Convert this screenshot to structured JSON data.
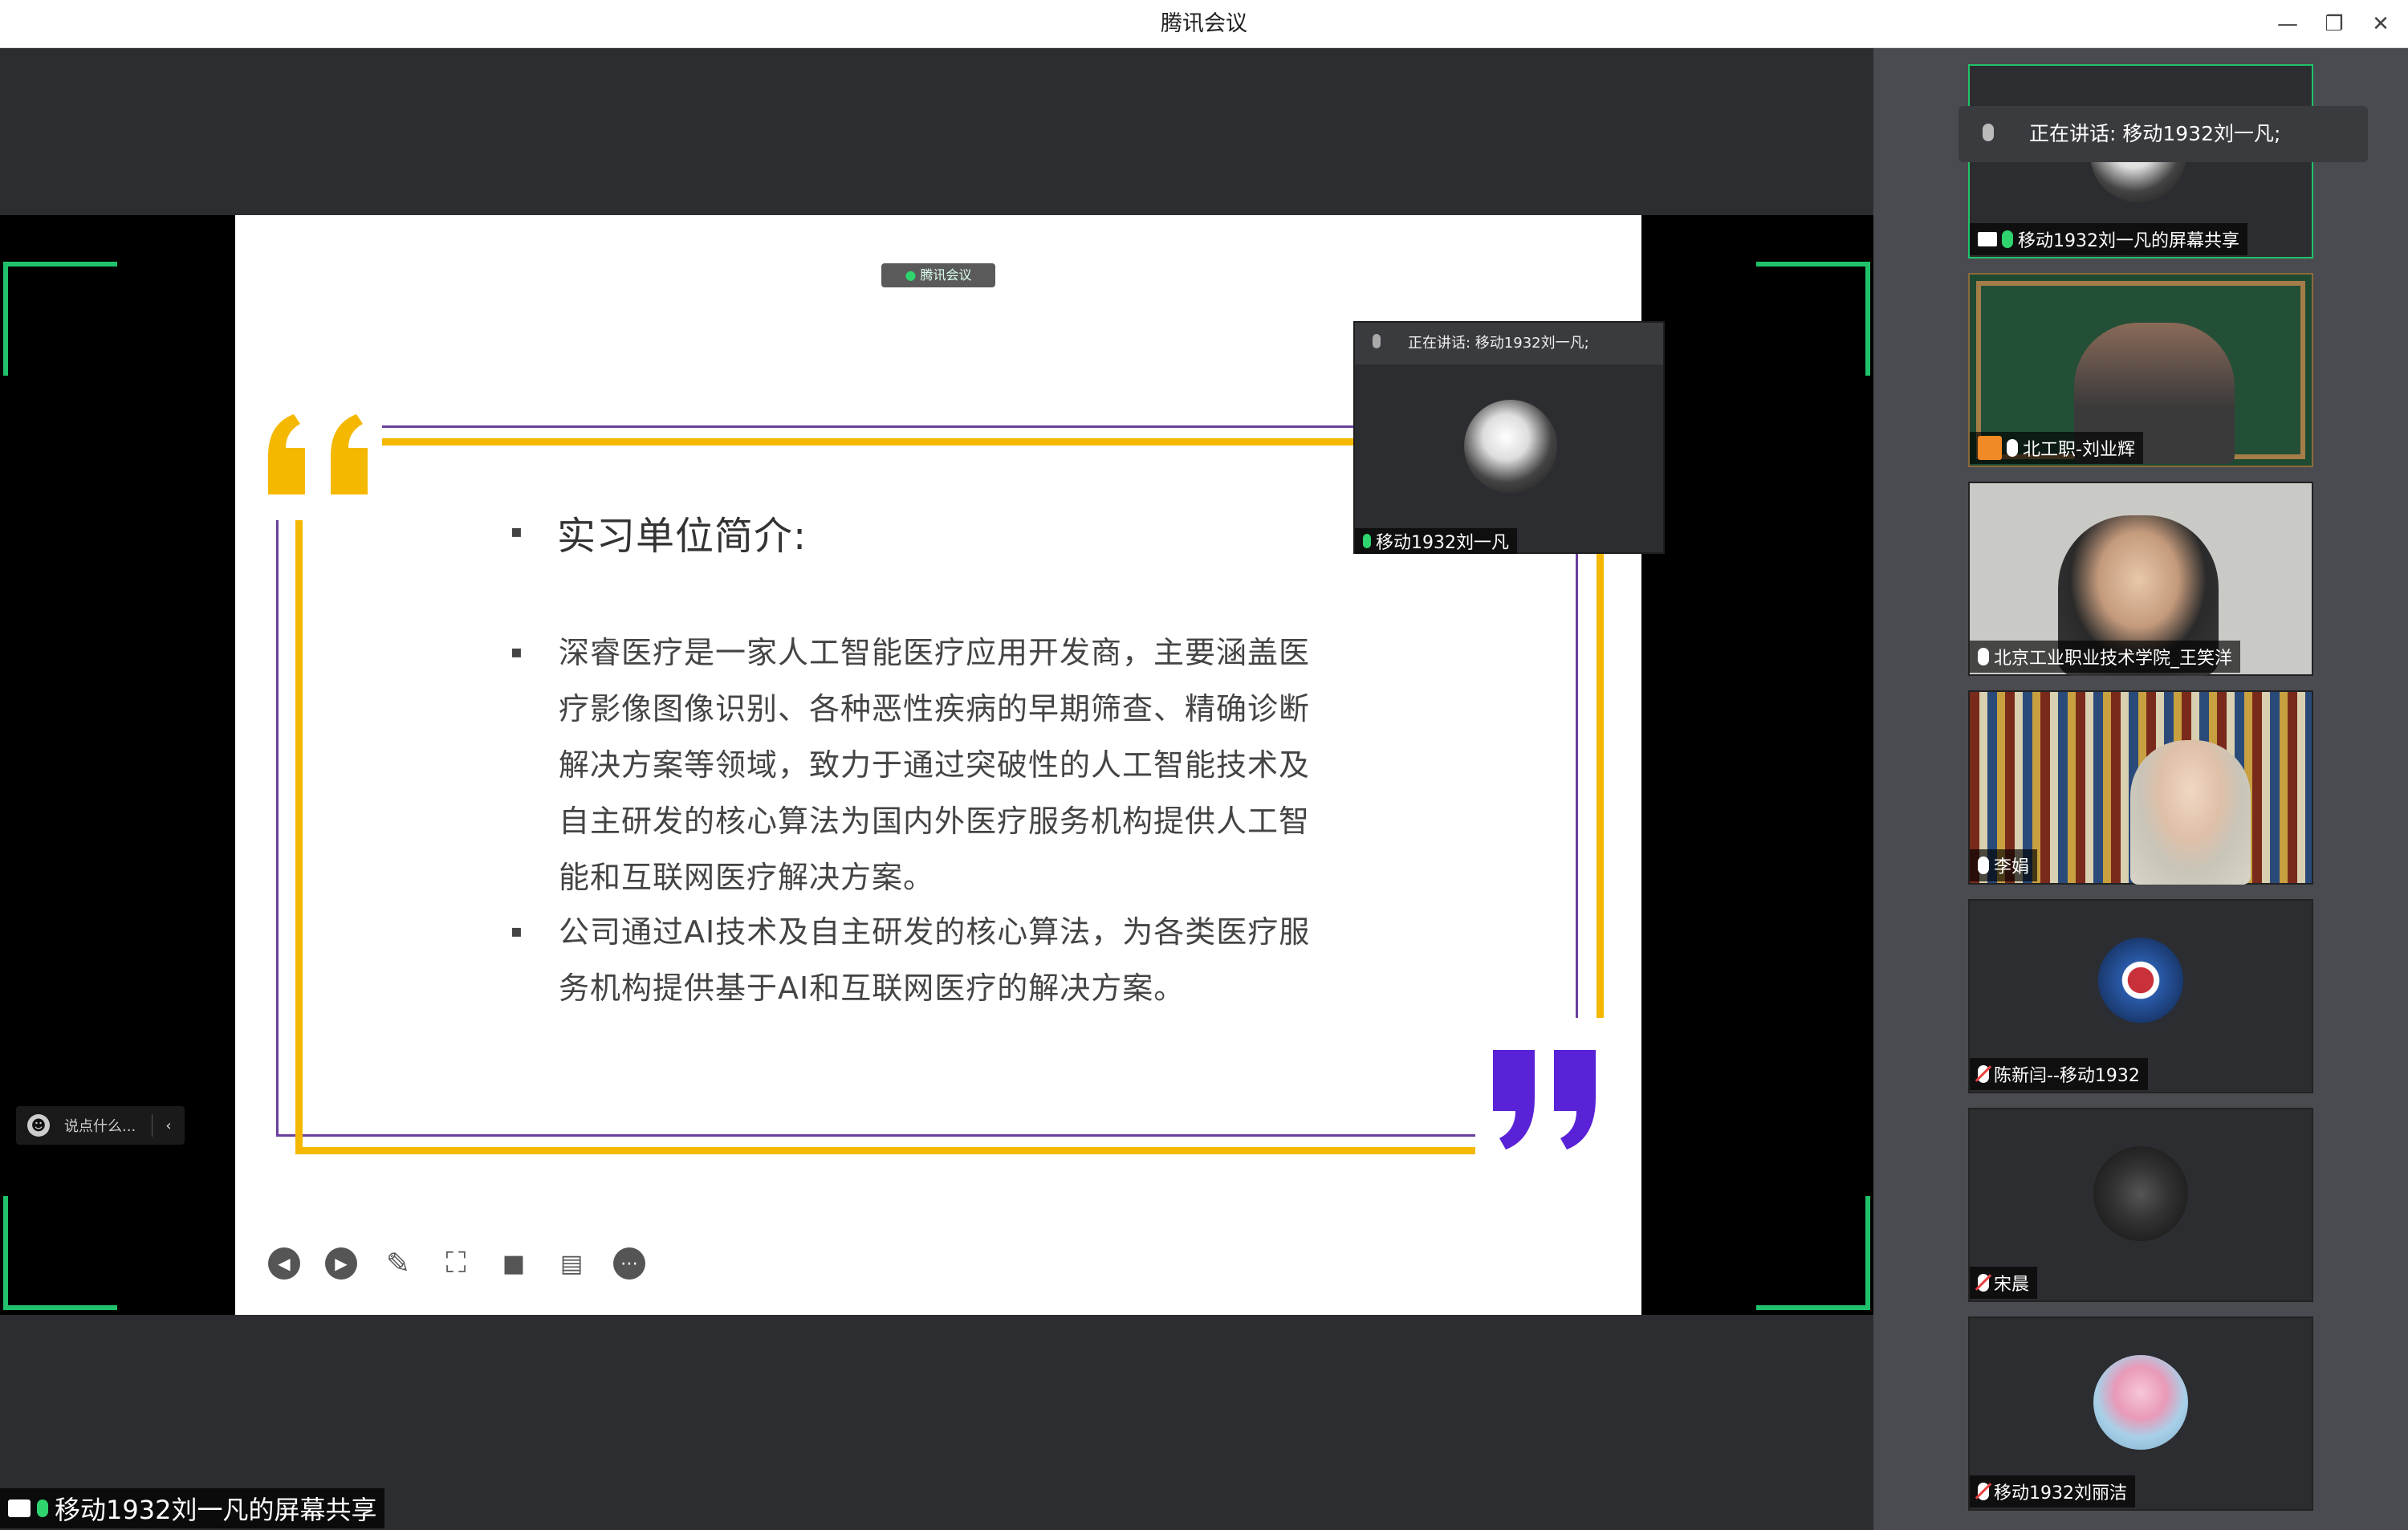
{
  "window": {
    "title": "腾讯会议"
  },
  "slide": {
    "heading": "实习单位简介:",
    "paragraphs": [
      [
        "深睿医疗是一家人工智能医疗应用开发商，主要涵盖医",
        "疗影像图像识别、各种恶性疾病的早期筛查、精确诊断",
        "解决方案等领域，致力于通过突破性的人工智能技术及",
        "自主研发的核心算法为国内外医疗服务机构提供人工智",
        "能和互联网医疗解决方案。"
      ],
      [
        "公司通过AI技术及自主研发的核心算法，为各类医疗服",
        "务机构提供基于AI和互联网医疗的解决方案。"
      ]
    ],
    "bullet": "▪",
    "brand_tag": "腾讯会议"
  },
  "speaker_card": {
    "label": "正在讲话: 移动1932刘一凡;",
    "name": "移动1932刘一凡"
  },
  "chat": {
    "placeholder": "说点什么..."
  },
  "share_label": "移动1932刘一凡的屏幕共享",
  "sidebar": {
    "speaking_bubble": "正在讲话: 移动1932刘一凡;",
    "tiles": [
      {
        "name": "移动1932刘一凡的屏幕共享",
        "mic": "green"
      },
      {
        "name": "北工职-刘业辉",
        "mic": "on"
      },
      {
        "name": "北京工业职业技术学院_王笑洋",
        "mic": "on"
      },
      {
        "name": "李娟",
        "mic": "on"
      },
      {
        "name": "陈新闫--移动1932",
        "mic": "muted"
      },
      {
        "name": "宋晨",
        "mic": "muted"
      },
      {
        "name": "移动1932刘丽洁",
        "mic": "muted"
      }
    ]
  },
  "colors": {
    "accent": "#1fc26b",
    "yellow": "#f5b800",
    "purple": "#5a22d6"
  }
}
